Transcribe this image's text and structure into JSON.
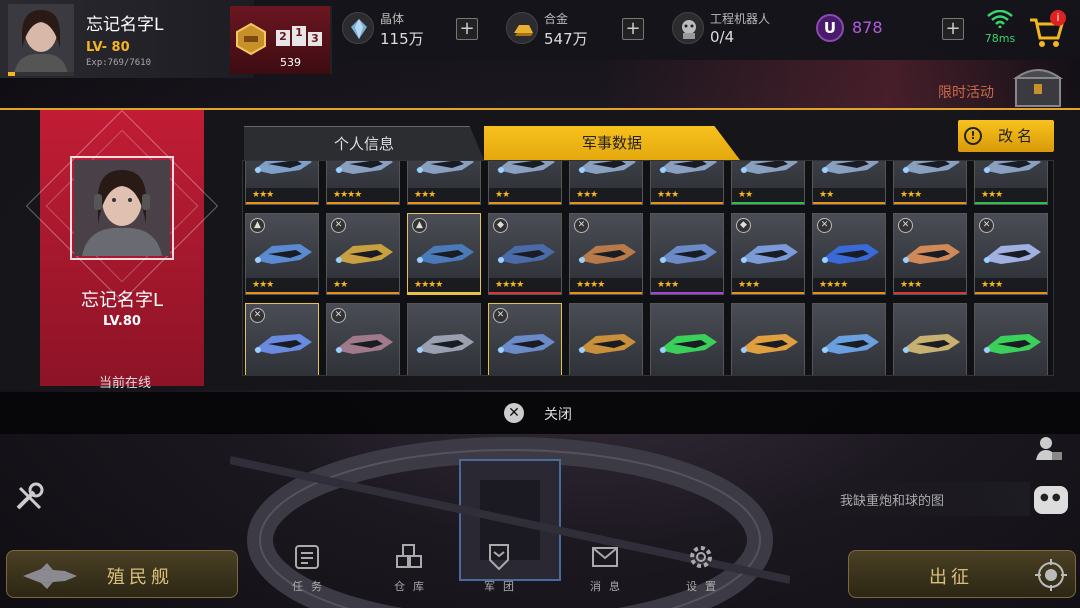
{
  "player": {
    "name": "忘记名字L",
    "level_label": "LV- 80",
    "exp_label": "Exp:769/7610",
    "exp_fraction": 0.101
  },
  "ranking": {
    "podium": [
      "2",
      "1",
      "3"
    ],
    "value": "539"
  },
  "resources": [
    {
      "label": "晶体",
      "value": "115万",
      "icon": "crystal-icon"
    },
    {
      "label": "合金",
      "value": "547万",
      "icon": "alloy-icon"
    },
    {
      "label": "工程机器人",
      "value": "0/4",
      "icon": "robot-icon"
    }
  ],
  "premium": {
    "symbol": "U",
    "value": "878",
    "color": "#b45be0"
  },
  "network": {
    "latency": "78ms",
    "color": "#3bd36b"
  },
  "shop": {
    "badge": "i"
  },
  "event": {
    "label": "限时活动"
  },
  "profile_panel": {
    "name": "忘记名字L",
    "level": "LV.80",
    "status": "当前在线"
  },
  "tabs": [
    {
      "label": "个人信息",
      "active": false
    },
    {
      "label": "军事数据",
      "active": true
    }
  ],
  "rename_button": {
    "label": "改名",
    "icon_glyph": "!"
  },
  "ships": [
    {
      "type": "",
      "stars": "★★★",
      "rarity": "orange",
      "color": "#7fa0c8"
    },
    {
      "type": "",
      "stars": "★★★★",
      "rarity": "orange",
      "color": "#8aa0c0"
    },
    {
      "type": "",
      "stars": "★★★",
      "rarity": "orange",
      "color": "#8aa0c0"
    },
    {
      "type": "",
      "stars": "★★",
      "rarity": "orange",
      "color": "#8aa0c0"
    },
    {
      "type": "",
      "stars": "★★★",
      "rarity": "orange",
      "color": "#8aa0c0"
    },
    {
      "type": "",
      "stars": "★★★",
      "rarity": "orange",
      "color": "#8aa0c0"
    },
    {
      "type": "",
      "stars": "★★",
      "rarity": "green",
      "color": "#8aa0c0"
    },
    {
      "type": "",
      "stars": "★★",
      "rarity": "orange",
      "color": "#8aa0c0"
    },
    {
      "type": "",
      "stars": "★★★",
      "rarity": "orange",
      "color": "#8aa0c0"
    },
    {
      "type": "",
      "stars": "★★★",
      "rarity": "green",
      "color": "#8aa0c0"
    },
    {
      "type": "▲",
      "stars": "★★★",
      "rarity": "orange",
      "color": "#5a8ad0"
    },
    {
      "type": "✕",
      "stars": "★★",
      "rarity": "orange",
      "color": "#c8a040"
    },
    {
      "type": "▲",
      "stars": "★★★★",
      "rarity": "yellow",
      "color": "#4a7ab8",
      "highlight": true
    },
    {
      "type": "◆",
      "stars": "★★★★",
      "rarity": "red",
      "color": "#4a6aa8"
    },
    {
      "type": "✕",
      "stars": "★★★★",
      "rarity": "orange",
      "color": "#b87a4a"
    },
    {
      "type": "",
      "stars": "★★★",
      "rarity": "purple",
      "color": "#6a8ac8"
    },
    {
      "type": "◆",
      "stars": "★★★",
      "rarity": "orange",
      "color": "#7a9ad8"
    },
    {
      "type": "✕",
      "stars": "★★★★",
      "rarity": "orange",
      "color": "#3a6ad8"
    },
    {
      "type": "✕",
      "stars": "★★★",
      "rarity": "red",
      "color": "#d08a5a"
    },
    {
      "type": "✕",
      "stars": "★★★",
      "rarity": "orange",
      "color": "#a0b0e0"
    },
    {
      "type": "✕",
      "stars": "",
      "rarity": "",
      "color": "#6a8ae0",
      "highlight": true
    },
    {
      "type": "✕",
      "stars": "",
      "rarity": "",
      "color": "#a07a8a"
    },
    {
      "type": "",
      "stars": "",
      "rarity": "",
      "color": "#9aa0b0"
    },
    {
      "type": "✕",
      "stars": "",
      "rarity": "",
      "color": "#6a8ac8",
      "highlight": true
    },
    {
      "type": "",
      "stars": "",
      "rarity": "",
      "color": "#c8903a"
    },
    {
      "type": "",
      "stars": "",
      "rarity": "",
      "color": "#3ad05a"
    },
    {
      "type": "",
      "stars": "",
      "rarity": "",
      "color": "#e0a040"
    },
    {
      "type": "",
      "stars": "",
      "rarity": "",
      "color": "#6aa0e0"
    },
    {
      "type": "",
      "stars": "",
      "rarity": "",
      "color": "#c8b070"
    },
    {
      "type": "",
      "stars": "",
      "rarity": "",
      "color": "#3ad05a"
    }
  ],
  "close_button": {
    "label": "关闭",
    "glyph": "✕"
  },
  "chat": {
    "message": "我缺重炮和球的图"
  },
  "bottom": {
    "left_button": "殖民舰",
    "right_button": "出征",
    "nav": [
      {
        "label": "任务",
        "icon": "mission-icon"
      },
      {
        "label": "仓库",
        "icon": "warehouse-icon"
      },
      {
        "label": "军团",
        "icon": "legion-icon"
      },
      {
        "label": "消息",
        "icon": "message-icon"
      },
      {
        "label": "设置",
        "icon": "settings-icon"
      }
    ]
  },
  "colors": {
    "accent": "#f3b61e",
    "panel_red": "#c11d35"
  }
}
